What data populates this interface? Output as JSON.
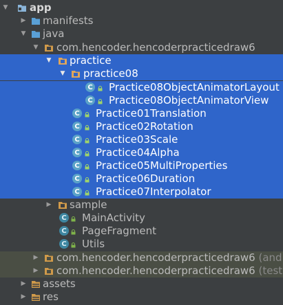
{
  "tree": {
    "app": "app",
    "manifests": "manifests",
    "java": "java",
    "pkg_main": "com.hencoder.hencoderpracticedraw6",
    "practice": "practice",
    "practice08": "practice08",
    "p08_layout": "Practice08ObjectAnimatorLayout",
    "p08_view": "Practice08ObjectAnimatorView",
    "p01": "Practice01Translation",
    "p02": "Practice02Rotation",
    "p03": "Practice03Scale",
    "p04": "Practice04Alpha",
    "p05": "Practice05MultiProperties",
    "p06": "Practice06Duration",
    "p07": "Practice07Interpolator",
    "sample": "sample",
    "main_activity": "MainActivity",
    "page_fragment": "PageFragment",
    "utils": "Utils",
    "pkg_android": "com.hencoder.hencoderpracticedraw6",
    "pkg_android_suffix": "(androi",
    "pkg_test": "com.hencoder.hencoderpracticedraw6",
    "pkg_test_suffix": "(test)",
    "assets": "assets",
    "res": "res"
  },
  "icons": {
    "class_letter": "C"
  },
  "colors": {
    "background": "#3c3f41",
    "selection": "#2f65ca",
    "folder_blue": "#5aa0d6",
    "package_orange": "#d09a4a",
    "class_teal": "#3e86a0",
    "lock_green": "#7fb34a"
  }
}
